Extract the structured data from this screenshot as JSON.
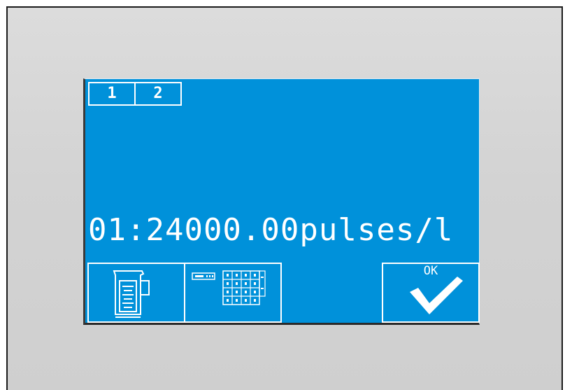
{
  "tabs": [
    {
      "label": "1"
    },
    {
      "label": "2"
    }
  ],
  "display": {
    "readout": "01:24000.00pulses/l"
  },
  "buttons": {
    "measure_icon": "measuring-jug-icon",
    "keypad_icon": "numeric-keypad-icon",
    "ok_label": "OK",
    "ok_icon": "checkmark-icon"
  },
  "colors": {
    "screen_background": "#0091da",
    "foreground": "#ffffff",
    "bezel": "#d3d3d3"
  }
}
